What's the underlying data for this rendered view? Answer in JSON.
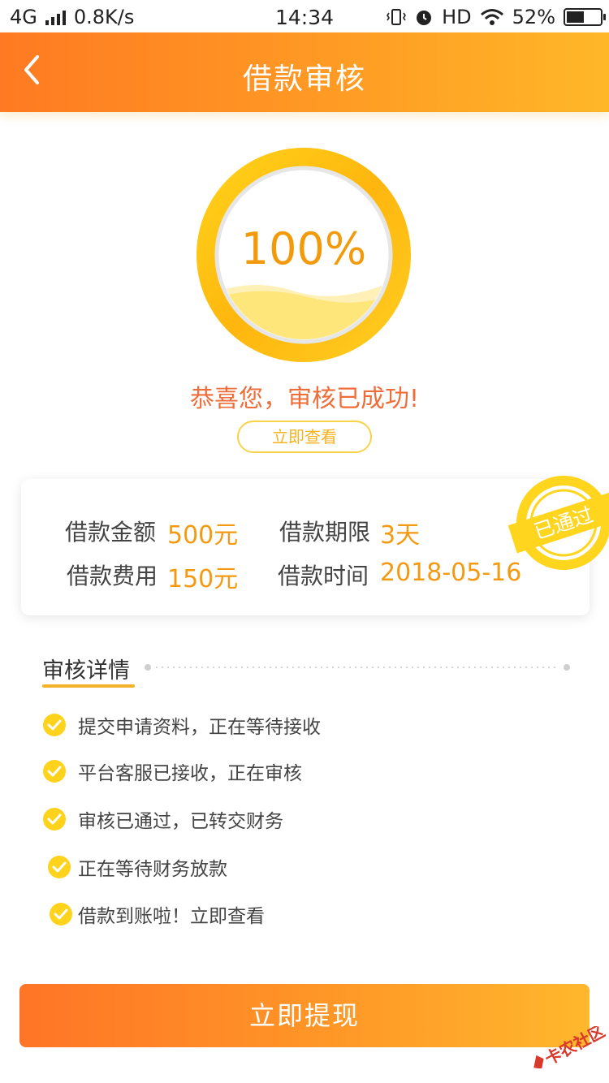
{
  "status_bar": {
    "network": "4G",
    "speed": "0.8K/s",
    "time": "14:34",
    "hd": "HD",
    "battery_text": "52%",
    "battery_level": 0.52
  },
  "header": {
    "title": "借款审核"
  },
  "progress": {
    "percent_text": "100%",
    "percent": 1.0
  },
  "result": {
    "message": "恭喜您，审核已成功!",
    "view_button": "立即查看"
  },
  "loan_info": {
    "amount_label": "借款金额",
    "amount_value": "500元",
    "term_label": "借款期限",
    "term_value": "3天",
    "fee_label": "借款费用",
    "fee_value": "150元",
    "time_label": "借款时间",
    "time_value": "2018-05-16",
    "stamp_text": "已通过"
  },
  "details": {
    "title": "审核详情",
    "steps": [
      {
        "label": "提交申请资料，正在等待接收"
      },
      {
        "label": "平台客服已接收，正在审核"
      },
      {
        "label": "审核已通过，已转交财务"
      },
      {
        "label": "正在等待财务放款"
      },
      {
        "label": "借款到账啦！立即查看"
      }
    ]
  },
  "cta": {
    "label": "立即提现"
  },
  "watermark": {
    "text": "卡农社区"
  },
  "colors": {
    "accent": "#ff8a24",
    "gold": "#f6b21f",
    "success_text": "#ef6d3a"
  }
}
